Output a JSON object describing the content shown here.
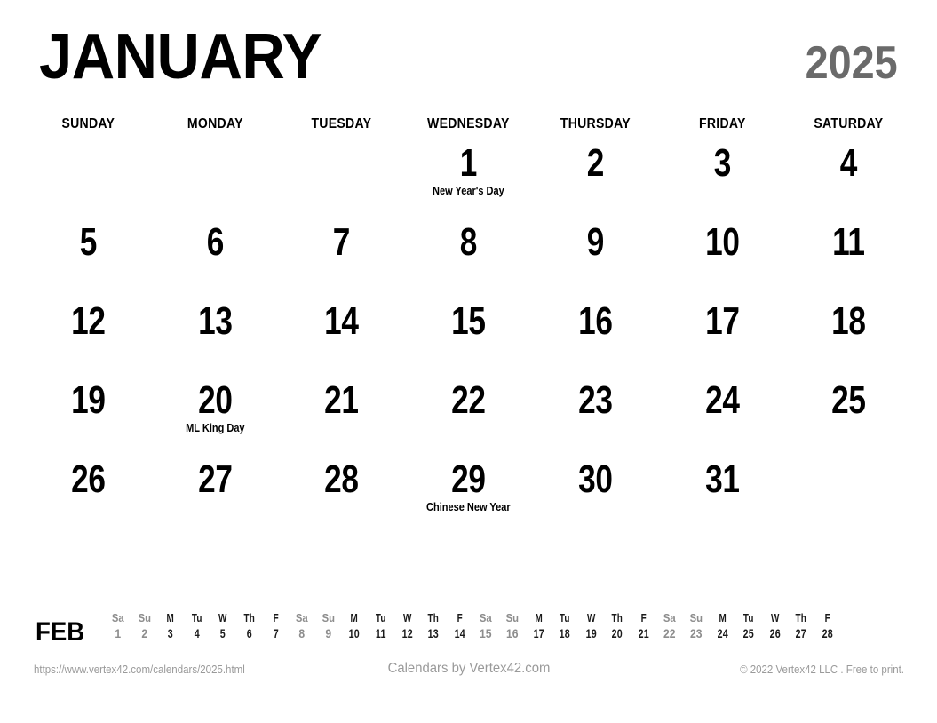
{
  "header": {
    "month": "JANUARY",
    "year": "2025"
  },
  "weekdays": [
    "SUNDAY",
    "MONDAY",
    "TUESDAY",
    "WEDNESDAY",
    "THURSDAY",
    "FRIDAY",
    "SATURDAY"
  ],
  "weeks": [
    [
      {
        "day": ""
      },
      {
        "day": ""
      },
      {
        "day": ""
      },
      {
        "day": "1",
        "event": "New Year's Day"
      },
      {
        "day": "2"
      },
      {
        "day": "3"
      },
      {
        "day": "4"
      }
    ],
    [
      {
        "day": "5"
      },
      {
        "day": "6"
      },
      {
        "day": "7"
      },
      {
        "day": "8"
      },
      {
        "day": "9"
      },
      {
        "day": "10"
      },
      {
        "day": "11"
      }
    ],
    [
      {
        "day": "12"
      },
      {
        "day": "13"
      },
      {
        "day": "14"
      },
      {
        "day": "15"
      },
      {
        "day": "16"
      },
      {
        "day": "17"
      },
      {
        "day": "18"
      }
    ],
    [
      {
        "day": "19"
      },
      {
        "day": "20",
        "event": "ML King Day"
      },
      {
        "day": "21"
      },
      {
        "day": "22"
      },
      {
        "day": "23"
      },
      {
        "day": "24"
      },
      {
        "day": "25"
      }
    ],
    [
      {
        "day": "26"
      },
      {
        "day": "27"
      },
      {
        "day": "28"
      },
      {
        "day": "29",
        "event": "Chinese New Year"
      },
      {
        "day": "30"
      },
      {
        "day": "31"
      },
      {
        "day": ""
      }
    ]
  ],
  "mini_month": {
    "label": "FEB",
    "days": [
      {
        "dow": "Sa",
        "num": "1",
        "weekend": true
      },
      {
        "dow": "Su",
        "num": "2",
        "weekend": true
      },
      {
        "dow": "M",
        "num": "3",
        "weekend": false
      },
      {
        "dow": "Tu",
        "num": "4",
        "weekend": false
      },
      {
        "dow": "W",
        "num": "5",
        "weekend": false
      },
      {
        "dow": "Th",
        "num": "6",
        "weekend": false
      },
      {
        "dow": "F",
        "num": "7",
        "weekend": false
      },
      {
        "dow": "Sa",
        "num": "8",
        "weekend": true
      },
      {
        "dow": "Su",
        "num": "9",
        "weekend": true
      },
      {
        "dow": "M",
        "num": "10",
        "weekend": false
      },
      {
        "dow": "Tu",
        "num": "11",
        "weekend": false
      },
      {
        "dow": "W",
        "num": "12",
        "weekend": false
      },
      {
        "dow": "Th",
        "num": "13",
        "weekend": false
      },
      {
        "dow": "F",
        "num": "14",
        "weekend": false
      },
      {
        "dow": "Sa",
        "num": "15",
        "weekend": true
      },
      {
        "dow": "Su",
        "num": "16",
        "weekend": true
      },
      {
        "dow": "M",
        "num": "17",
        "weekend": false
      },
      {
        "dow": "Tu",
        "num": "18",
        "weekend": false
      },
      {
        "dow": "W",
        "num": "19",
        "weekend": false
      },
      {
        "dow": "Th",
        "num": "20",
        "weekend": false
      },
      {
        "dow": "F",
        "num": "21",
        "weekend": false
      },
      {
        "dow": "Sa",
        "num": "22",
        "weekend": true
      },
      {
        "dow": "Su",
        "num": "23",
        "weekend": true
      },
      {
        "dow": "M",
        "num": "24",
        "weekend": false
      },
      {
        "dow": "Tu",
        "num": "25",
        "weekend": false
      },
      {
        "dow": "W",
        "num": "26",
        "weekend": false
      },
      {
        "dow": "Th",
        "num": "27",
        "weekend": false
      },
      {
        "dow": "F",
        "num": "28",
        "weekend": false
      }
    ]
  },
  "footer": {
    "url": "https://www.vertex42.com/calendars/2025.html",
    "credit": "Calendars by Vertex42.com",
    "copyright": "© 2022 Vertex42 LLC . Free to print."
  },
  "colors": {
    "text": "#000000",
    "year_gray": "#6a6a6a",
    "footer_gray": "#9a9a9a",
    "mini_weekend_gray": "#8d8d8d",
    "background": "#ffffff"
  }
}
